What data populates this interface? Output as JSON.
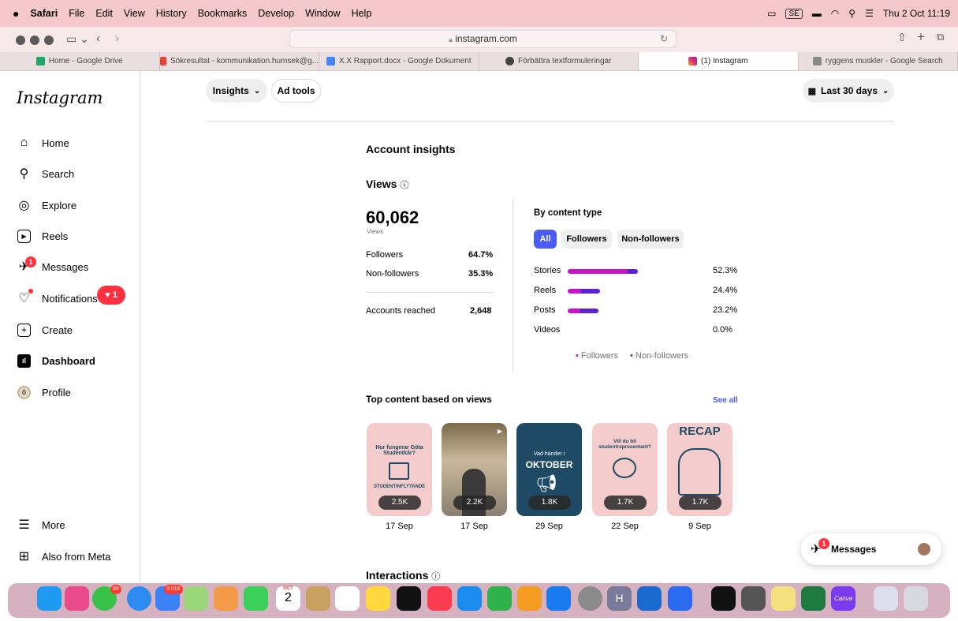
{
  "menubar": {
    "app": "Safari",
    "items": [
      "File",
      "Edit",
      "View",
      "History",
      "Bookmarks",
      "Develop",
      "Window",
      "Help"
    ],
    "clock": "Thu 2 Oct 11:19",
    "lang": "SE"
  },
  "browser": {
    "url": "instagram.com",
    "tabs": [
      {
        "label": "Home - Google Drive",
        "color": "#1fa463"
      },
      {
        "label": "Sökresultat - kommunikation.humsek@g...",
        "color": "#ea4335"
      },
      {
        "label": "X.X Rapport.docx - Google Dokument",
        "color": "#4285f4"
      },
      {
        "label": "Förbättra textformuleringar",
        "color": "#444444"
      },
      {
        "label": "(1) Instagram",
        "color": "#e1306c"
      },
      {
        "label": "ryggens muskler - Google Search",
        "color": "#888888"
      }
    ]
  },
  "sidebar": {
    "logo": "Instagram",
    "items": [
      {
        "label": "Home",
        "icon": "home-icon",
        "glyph": "⌂"
      },
      {
        "label": "Search",
        "icon": "search-icon",
        "glyph": "⚲"
      },
      {
        "label": "Explore",
        "icon": "compass-icon",
        "glyph": "◎"
      },
      {
        "label": "Reels",
        "icon": "reels-icon",
        "glyph": "▷"
      },
      {
        "label": "Messages",
        "icon": "messenger-icon",
        "glyph": "✈",
        "badge": "1"
      },
      {
        "label": "Notifications",
        "icon": "heart-icon",
        "glyph": "♡",
        "badge": "1"
      },
      {
        "label": "Create",
        "icon": "plus-square-icon",
        "glyph": "⊞"
      },
      {
        "label": "Dashboard",
        "icon": "dashboard-icon",
        "glyph": "▮"
      },
      {
        "label": "Profile",
        "icon": "avatar-icon",
        "glyph": "●"
      }
    ],
    "more": "More",
    "meta": "Also from Meta"
  },
  "toolbar": {
    "insights": "Insights",
    "adtools": "Ad tools",
    "daterange": "Last 30 days"
  },
  "insights": {
    "title": "Account insights",
    "views_title": "Views",
    "total": "60,062",
    "total_label": "Views",
    "followers_label": "Followers",
    "followers_pct": "64.7%",
    "nonfollowers_label": "Non-followers",
    "nonfollowers_pct": "35.3%",
    "reached_label": "Accounts reached",
    "reached_value": "2,648",
    "by_content": "By content type",
    "chips": [
      "All",
      "Followers",
      "Non-followers"
    ],
    "legend_followers": "Followers",
    "legend_nonfollowers": "Non-followers",
    "rows": [
      {
        "label": "Stories",
        "pct": "52.3%",
        "value": 52.3,
        "followers_share": 0.85
      },
      {
        "label": "Reels",
        "pct": "24.4%",
        "value": 24.4,
        "followers_share": 0.4
      },
      {
        "label": "Posts",
        "pct": "23.2%",
        "value": 23.2,
        "followers_share": 0.4
      },
      {
        "label": "Videos",
        "pct": "0.0%",
        "value": 0,
        "followers_share": 0
      }
    ],
    "top_title": "Top content based on views",
    "see_all": "See all",
    "interactions": "Interactions",
    "colors": {
      "followers": "#c912c9",
      "nonfollowers": "#5b21d6",
      "accent": "#4a5df9"
    }
  },
  "top_content": [
    {
      "count": "2.5K",
      "date": "17 Sep",
      "bg": "#f5cccc",
      "text": "Hur fungerar Göta Studentkår?",
      "sub": "STUDENTINFLYTANDE"
    },
    {
      "count": "2.2K",
      "date": "17 Sep",
      "bg": "#c9b89a",
      "text": "",
      "sub": ""
    },
    {
      "count": "1.8K",
      "date": "29 Sep",
      "bg": "#1f4a66",
      "text": "Vad händer i",
      "sub": "OKTOBER"
    },
    {
      "count": "1.7K",
      "date": "22 Sep",
      "bg": "#f5cccc",
      "text": "Vill du bli studentrepresentant?",
      "sub": ""
    },
    {
      "count": "1.7K",
      "date": "9 Sep",
      "bg": "#f5cccc",
      "text": "",
      "sub": "RECAP"
    }
  ],
  "messages": {
    "label": "Messages",
    "badge": "1"
  },
  "dock": {
    "mail_badge": "3 018",
    "messages_badge": "99",
    "calendar_month": "OCT",
    "calendar_day": "2",
    "hey_letter": "H",
    "canva": "Canva"
  }
}
